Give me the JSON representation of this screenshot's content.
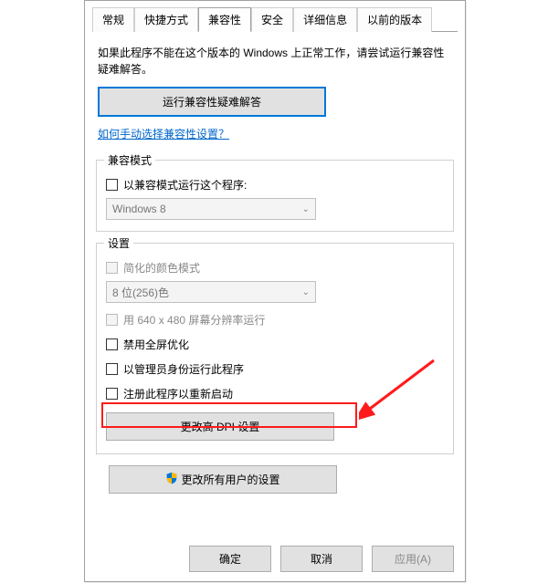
{
  "tabs": {
    "general": "常规",
    "shortcut": "快捷方式",
    "compatibility": "兼容性",
    "security": "安全",
    "details": "详细信息",
    "previous": "以前的版本"
  },
  "intro": "如果此程序不能在这个版本的 Windows 上正常工作，请尝试运行兼容性疑难解答。",
  "troubleshootBtn": "运行兼容性疑难解答",
  "manualLink": "如何手动选择兼容性设置？",
  "groupCompat": {
    "title": "兼容模式",
    "checkbox": "以兼容模式运行这个程序:",
    "selectValue": "Windows 8"
  },
  "groupSettings": {
    "title": "设置",
    "reducedColor": "简化的颜色模式",
    "colorSelect": "8 位(256)色",
    "lowRes": "用 640 x 480 屏幕分辨率运行",
    "disableFullscreen": "禁用全屏优化",
    "runAsAdmin": "以管理员身份运行此程序",
    "registerRestart": "注册此程序以重新启动",
    "dpiBtn": "更改高 DPI 设置"
  },
  "allUsersBtn": "更改所有用户的设置",
  "footer": {
    "ok": "确定",
    "cancel": "取消",
    "apply": "应用",
    "applyAccel": "(A)"
  }
}
